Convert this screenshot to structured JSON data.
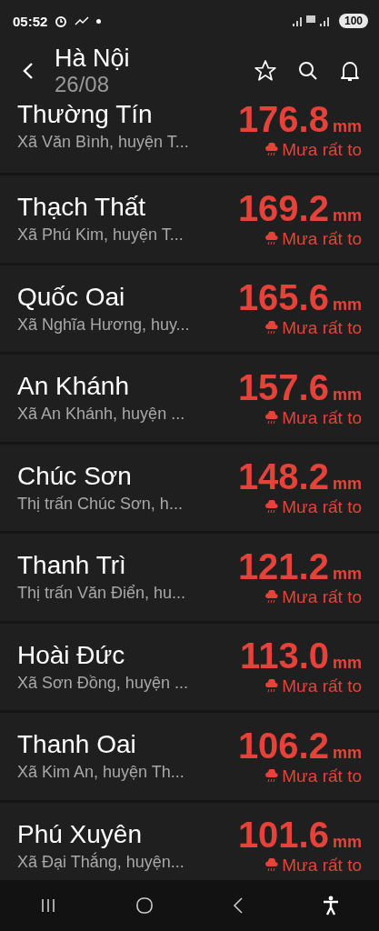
{
  "status_bar": {
    "time": "05:52",
    "battery": "100"
  },
  "header": {
    "title": "Hà Nội",
    "date": "26/08"
  },
  "stations": [
    {
      "name": "Thường Tín",
      "location": "Xã Văn Bình, huyện T...",
      "amount": "176.8",
      "unit": "mm",
      "condition": "Mưa rất to"
    },
    {
      "name": "Thạch Thất",
      "location": "Xã Phú Kim, huyện T...",
      "amount": "169.2",
      "unit": "mm",
      "condition": "Mưa rất to"
    },
    {
      "name": "Quốc Oai",
      "location": "Xã Nghĩa Hương, huy...",
      "amount": "165.6",
      "unit": "mm",
      "condition": "Mưa rất to"
    },
    {
      "name": "An Khánh",
      "location": "Xã An Khánh, huyện ...",
      "amount": "157.6",
      "unit": "mm",
      "condition": "Mưa rất to"
    },
    {
      "name": "Chúc Sơn",
      "location": "Thị trấn Chúc Sơn, h...",
      "amount": "148.2",
      "unit": "mm",
      "condition": "Mưa rất to"
    },
    {
      "name": "Thanh Trì",
      "location": "Thị trấn Văn Điển, hu...",
      "amount": "121.2",
      "unit": "mm",
      "condition": "Mưa rất to"
    },
    {
      "name": "Hoài Đức",
      "location": "Xã Sơn Đồng, huyện ...",
      "amount": "113.0",
      "unit": "mm",
      "condition": "Mưa rất to"
    },
    {
      "name": "Thanh Oai",
      "location": "Xã Kim An, huyện Th...",
      "amount": "106.2",
      "unit": "mm",
      "condition": "Mưa rất to"
    },
    {
      "name": "Phú Xuyên",
      "location": "Xã Đại Thắng,  huyện...",
      "amount": "101.6",
      "unit": "mm",
      "condition": "Mưa rất to"
    }
  ]
}
